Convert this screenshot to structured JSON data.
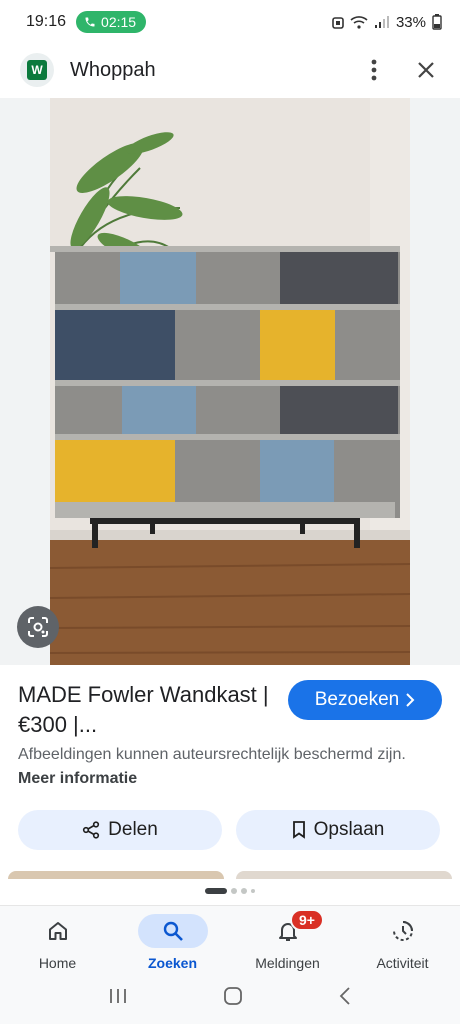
{
  "status": {
    "time": "19:16",
    "call_timer": "02:15",
    "battery": "33%"
  },
  "app": {
    "title": "Whoppah",
    "logo_letter": "W"
  },
  "result": {
    "title": "MADE Fowler Wandkast | €300 |...",
    "visit_label": "Bezoeken",
    "copyright_text": "Afbeeldingen kunnen auteursrechtelijk beschermd zijn.",
    "more_info": "Meer informatie",
    "share_label": "Delen",
    "save_label": "Opslaan"
  },
  "bottom_nav": {
    "items": [
      {
        "label": "Home",
        "icon": "home-icon"
      },
      {
        "label": "Zoeken",
        "icon": "search-icon",
        "active": true
      },
      {
        "label": "Meldingen",
        "icon": "bell-icon",
        "badge": "9+"
      },
      {
        "label": "Activiteit",
        "icon": "activity-icon"
      }
    ]
  },
  "colors": {
    "accent": "#1a73e8",
    "chip_bg": "#e8f0fe",
    "call_green": "#2fb56a",
    "badge_red": "#d93025"
  }
}
